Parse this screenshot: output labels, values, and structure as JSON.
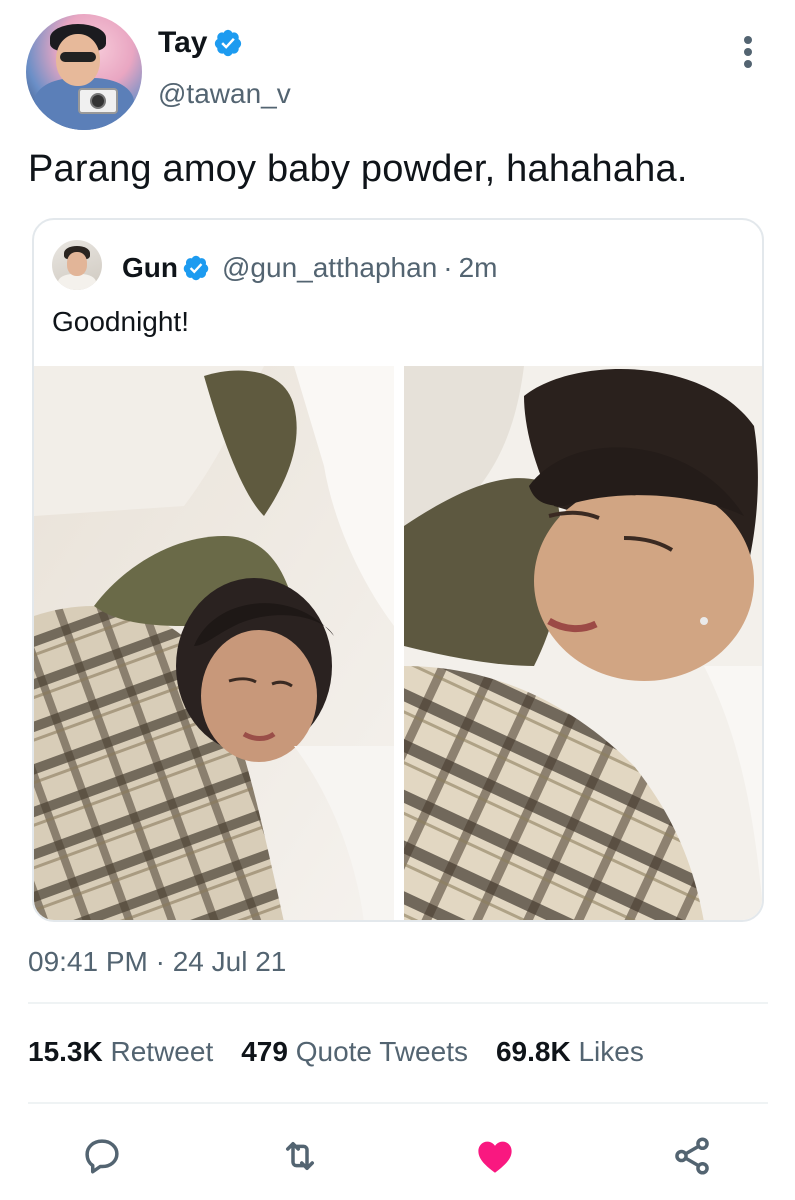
{
  "author": {
    "display_name": "Tay",
    "handle": "@tawan_v",
    "verified": true
  },
  "tweet": {
    "text": "Parang amoy baby powder, hahahaha.",
    "timestamp": "09:41 PM · 24 Jul 21"
  },
  "quoted_tweet": {
    "display_name": "Gun",
    "handle": "@gun_atthaphan",
    "separator": "·",
    "time": "2m",
    "text": "Goodnight!"
  },
  "stats": {
    "retweets_count": "15.3K",
    "retweets_label": "Retweet",
    "quotes_count": "479",
    "quotes_label": "Quote Tweets",
    "likes_count": "69.8K",
    "likes_label": "Likes"
  },
  "actions": [
    {
      "icon": "reply-icon"
    },
    {
      "icon": "retweet-icon"
    },
    {
      "icon": "like-icon",
      "active": true
    },
    {
      "icon": "share-icon"
    }
  ],
  "colors": {
    "verified": "#1d9bf0",
    "secondary_text": "#536471",
    "like_active": "#f91880",
    "border": "#e3e8ec"
  }
}
